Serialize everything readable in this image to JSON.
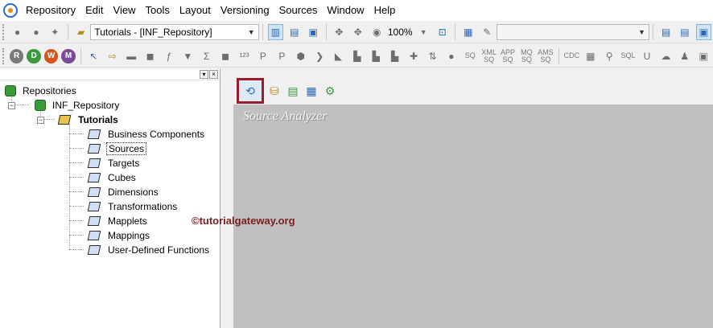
{
  "menubar": {
    "items": [
      "Repository",
      "Edit",
      "View",
      "Tools",
      "Layout",
      "Versioning",
      "Sources",
      "Window",
      "Help"
    ]
  },
  "toolbar": {
    "folder_combo": "Tutorials - [INF_Repository]",
    "zoom": "100%",
    "mode_buttons": [
      "R",
      "D",
      "W",
      "M"
    ]
  },
  "tree": {
    "root": "Repositories",
    "repository": "INF_Repository",
    "folder": "Tutorials",
    "nodes": [
      "Business Components",
      "Sources",
      "Targets",
      "Cubes",
      "Dimensions",
      "Transformations",
      "Mapplets",
      "Mappings",
      "User-Defined Functions"
    ],
    "selected": "Sources"
  },
  "workspace": {
    "title": "Source Analyzer"
  },
  "watermark": "©tutorialgateway.org",
  "colors": {
    "workspace_bg": "#c0c0c0",
    "highlight_border": "#9a1b2a",
    "watermark": "#7a2020"
  }
}
